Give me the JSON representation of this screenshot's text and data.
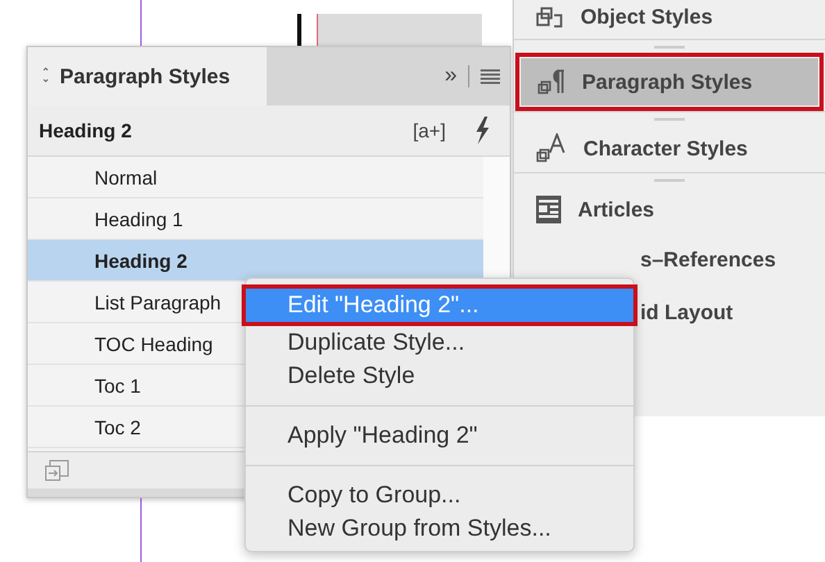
{
  "panel": {
    "tab": "Paragraph Styles",
    "tab_arrows": "⌃⌄",
    "more": "»",
    "current_style": "Heading 2",
    "new_style_hint": "[a+]",
    "styles": [
      {
        "label": "Normal",
        "selected": false
      },
      {
        "label": "Heading 1",
        "selected": false
      },
      {
        "label": "Heading 2",
        "selected": true
      },
      {
        "label": "List Paragraph",
        "selected": false
      },
      {
        "label": "TOC Heading",
        "selected": false
      },
      {
        "label": "Toc 1",
        "selected": false
      },
      {
        "label": "Toc 2",
        "selected": false
      }
    ]
  },
  "dock": [
    {
      "label": "Object Styles",
      "kind": "object",
      "selected": false
    },
    {
      "label": "Paragraph Styles",
      "kind": "paragraph",
      "selected": true
    },
    {
      "label": "Character Styles",
      "kind": "character",
      "selected": false
    },
    {
      "label": "Articles",
      "kind": "articles",
      "selected": false
    },
    {
      "label": "s–References",
      "kind": "covered",
      "selected": false
    },
    {
      "label": "id Layout",
      "kind": "covered",
      "selected": false
    }
  ],
  "context_menu": [
    [
      {
        "label": "Edit \"Heading 2\"...",
        "selected": true
      },
      {
        "label": "Duplicate Style...",
        "selected": false
      },
      {
        "label": "Delete Style",
        "selected": false
      }
    ],
    [
      {
        "label": "Apply \"Heading 2\"",
        "selected": false
      }
    ],
    [
      {
        "label": "Copy to Group...",
        "selected": false
      },
      {
        "label": "New Group from Styles...",
        "selected": false
      }
    ]
  ]
}
